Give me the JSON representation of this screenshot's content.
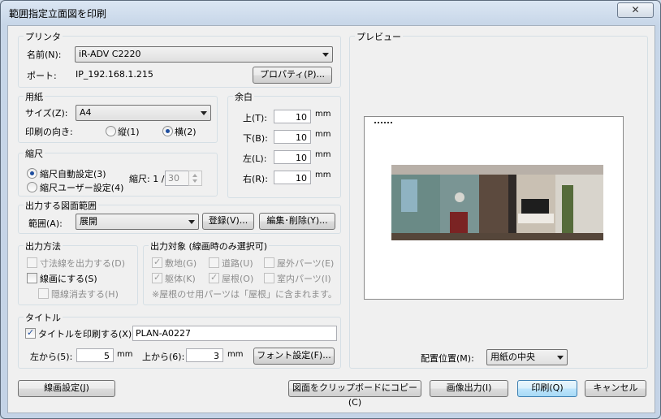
{
  "window": {
    "title": "範囲指定立面図を印刷",
    "close_glyph": "✕"
  },
  "printer": {
    "group": "プリンタ",
    "name_label": "名前(N):",
    "name_value": "iR-ADV C2220",
    "port_label": "ポート:",
    "port_value": "IP_192.168.1.215",
    "properties_btn": "プロパティ(P)..."
  },
  "paper": {
    "group": "用紙",
    "size_label": "サイズ(Z):",
    "size_value": "A4",
    "orient_label": "印刷の向き:",
    "portrait": "縦(1)",
    "landscape": "横(2)",
    "selected_orientation": "landscape"
  },
  "margin": {
    "group": "余白",
    "top_label": "上(T):",
    "top": "10",
    "bottom_label": "下(B):",
    "bottom": "10",
    "left_label": "左(L):",
    "left": "10",
    "right_label": "右(R):",
    "right": "10",
    "unit": "mm"
  },
  "scale": {
    "group": "縮尺",
    "auto": "縮尺自動設定(3)",
    "user": "縮尺ユーザー設定(4)",
    "selected": "auto",
    "scale_label": "縮尺: 1 /",
    "scale_value": "30"
  },
  "range": {
    "group": "出力する図面範囲",
    "range_label": "範囲(A):",
    "range_value": "展開",
    "register_btn": "登録(V)...",
    "edit_btn": "編集･削除(Y)..."
  },
  "method": {
    "group": "出力方法",
    "dimension_lines": "寸法線を出力する(D)",
    "line_drawing": "線画にする(S)",
    "hidden_lines": "隠線消去する(H)"
  },
  "targets": {
    "group": "出力対象 (線画時のみ選択可)",
    "site": "敷地(G)",
    "road": "道路(U)",
    "exterior": "屋外パーツ(E)",
    "body": "躯体(K)",
    "roof": "屋根(O)",
    "interior": "室内パーツ(I)",
    "note": "※屋根のせ用パーツは「屋根」に含まれます。"
  },
  "title_section": {
    "group": "タイトル",
    "print_title": "タイトルを印刷する(X)",
    "title_value": "PLAN-A0227",
    "from_left_label": "左から(5):",
    "from_left": "5",
    "from_top_label": "上から(6):",
    "from_top": "3",
    "unit": "mm",
    "font_btn": "フォント設定(F)..."
  },
  "preview": {
    "group": "プレビュー",
    "position_label": "配置位置(M):",
    "position_value": "用紙の中央"
  },
  "footer": {
    "line_settings": "線画設定(J)",
    "copy_clipboard": "図面をクリップボードにコピー(C)",
    "image_output": "画像出力(I)",
    "print": "印刷(Q)",
    "cancel": "キャンセル"
  }
}
